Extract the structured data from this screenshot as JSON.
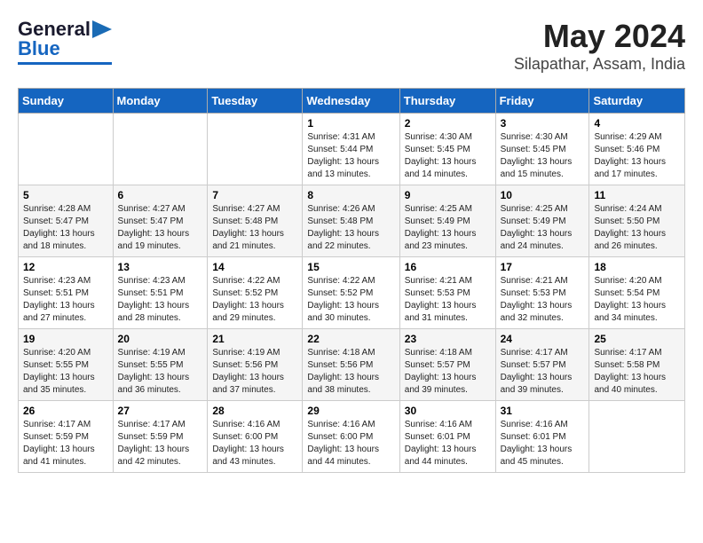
{
  "header": {
    "logo_line1": "General",
    "logo_line2": "Blue",
    "title": "May 2024",
    "subtitle": "Silapathar, Assam, India"
  },
  "weekdays": [
    "Sunday",
    "Monday",
    "Tuesday",
    "Wednesday",
    "Thursday",
    "Friday",
    "Saturday"
  ],
  "weeks": [
    [
      {
        "day": "",
        "info": ""
      },
      {
        "day": "",
        "info": ""
      },
      {
        "day": "",
        "info": ""
      },
      {
        "day": "1",
        "info": "Sunrise: 4:31 AM\nSunset: 5:44 PM\nDaylight: 13 hours\nand 13 minutes."
      },
      {
        "day": "2",
        "info": "Sunrise: 4:30 AM\nSunset: 5:45 PM\nDaylight: 13 hours\nand 14 minutes."
      },
      {
        "day": "3",
        "info": "Sunrise: 4:30 AM\nSunset: 5:45 PM\nDaylight: 13 hours\nand 15 minutes."
      },
      {
        "day": "4",
        "info": "Sunrise: 4:29 AM\nSunset: 5:46 PM\nDaylight: 13 hours\nand 17 minutes."
      }
    ],
    [
      {
        "day": "5",
        "info": "Sunrise: 4:28 AM\nSunset: 5:47 PM\nDaylight: 13 hours\nand 18 minutes."
      },
      {
        "day": "6",
        "info": "Sunrise: 4:27 AM\nSunset: 5:47 PM\nDaylight: 13 hours\nand 19 minutes."
      },
      {
        "day": "7",
        "info": "Sunrise: 4:27 AM\nSunset: 5:48 PM\nDaylight: 13 hours\nand 21 minutes."
      },
      {
        "day": "8",
        "info": "Sunrise: 4:26 AM\nSunset: 5:48 PM\nDaylight: 13 hours\nand 22 minutes."
      },
      {
        "day": "9",
        "info": "Sunrise: 4:25 AM\nSunset: 5:49 PM\nDaylight: 13 hours\nand 23 minutes."
      },
      {
        "day": "10",
        "info": "Sunrise: 4:25 AM\nSunset: 5:49 PM\nDaylight: 13 hours\nand 24 minutes."
      },
      {
        "day": "11",
        "info": "Sunrise: 4:24 AM\nSunset: 5:50 PM\nDaylight: 13 hours\nand 26 minutes."
      }
    ],
    [
      {
        "day": "12",
        "info": "Sunrise: 4:23 AM\nSunset: 5:51 PM\nDaylight: 13 hours\nand 27 minutes."
      },
      {
        "day": "13",
        "info": "Sunrise: 4:23 AM\nSunset: 5:51 PM\nDaylight: 13 hours\nand 28 minutes."
      },
      {
        "day": "14",
        "info": "Sunrise: 4:22 AM\nSunset: 5:52 PM\nDaylight: 13 hours\nand 29 minutes."
      },
      {
        "day": "15",
        "info": "Sunrise: 4:22 AM\nSunset: 5:52 PM\nDaylight: 13 hours\nand 30 minutes."
      },
      {
        "day": "16",
        "info": "Sunrise: 4:21 AM\nSunset: 5:53 PM\nDaylight: 13 hours\nand 31 minutes."
      },
      {
        "day": "17",
        "info": "Sunrise: 4:21 AM\nSunset: 5:53 PM\nDaylight: 13 hours\nand 32 minutes."
      },
      {
        "day": "18",
        "info": "Sunrise: 4:20 AM\nSunset: 5:54 PM\nDaylight: 13 hours\nand 34 minutes."
      }
    ],
    [
      {
        "day": "19",
        "info": "Sunrise: 4:20 AM\nSunset: 5:55 PM\nDaylight: 13 hours\nand 35 minutes."
      },
      {
        "day": "20",
        "info": "Sunrise: 4:19 AM\nSunset: 5:55 PM\nDaylight: 13 hours\nand 36 minutes."
      },
      {
        "day": "21",
        "info": "Sunrise: 4:19 AM\nSunset: 5:56 PM\nDaylight: 13 hours\nand 37 minutes."
      },
      {
        "day": "22",
        "info": "Sunrise: 4:18 AM\nSunset: 5:56 PM\nDaylight: 13 hours\nand 38 minutes."
      },
      {
        "day": "23",
        "info": "Sunrise: 4:18 AM\nSunset: 5:57 PM\nDaylight: 13 hours\nand 39 minutes."
      },
      {
        "day": "24",
        "info": "Sunrise: 4:17 AM\nSunset: 5:57 PM\nDaylight: 13 hours\nand 39 minutes."
      },
      {
        "day": "25",
        "info": "Sunrise: 4:17 AM\nSunset: 5:58 PM\nDaylight: 13 hours\nand 40 minutes."
      }
    ],
    [
      {
        "day": "26",
        "info": "Sunrise: 4:17 AM\nSunset: 5:59 PM\nDaylight: 13 hours\nand 41 minutes."
      },
      {
        "day": "27",
        "info": "Sunrise: 4:17 AM\nSunset: 5:59 PM\nDaylight: 13 hours\nand 42 minutes."
      },
      {
        "day": "28",
        "info": "Sunrise: 4:16 AM\nSunset: 6:00 PM\nDaylight: 13 hours\nand 43 minutes."
      },
      {
        "day": "29",
        "info": "Sunrise: 4:16 AM\nSunset: 6:00 PM\nDaylight: 13 hours\nand 44 minutes."
      },
      {
        "day": "30",
        "info": "Sunrise: 4:16 AM\nSunset: 6:01 PM\nDaylight: 13 hours\nand 44 minutes."
      },
      {
        "day": "31",
        "info": "Sunrise: 4:16 AM\nSunset: 6:01 PM\nDaylight: 13 hours\nand 45 minutes."
      },
      {
        "day": "",
        "info": ""
      }
    ]
  ]
}
